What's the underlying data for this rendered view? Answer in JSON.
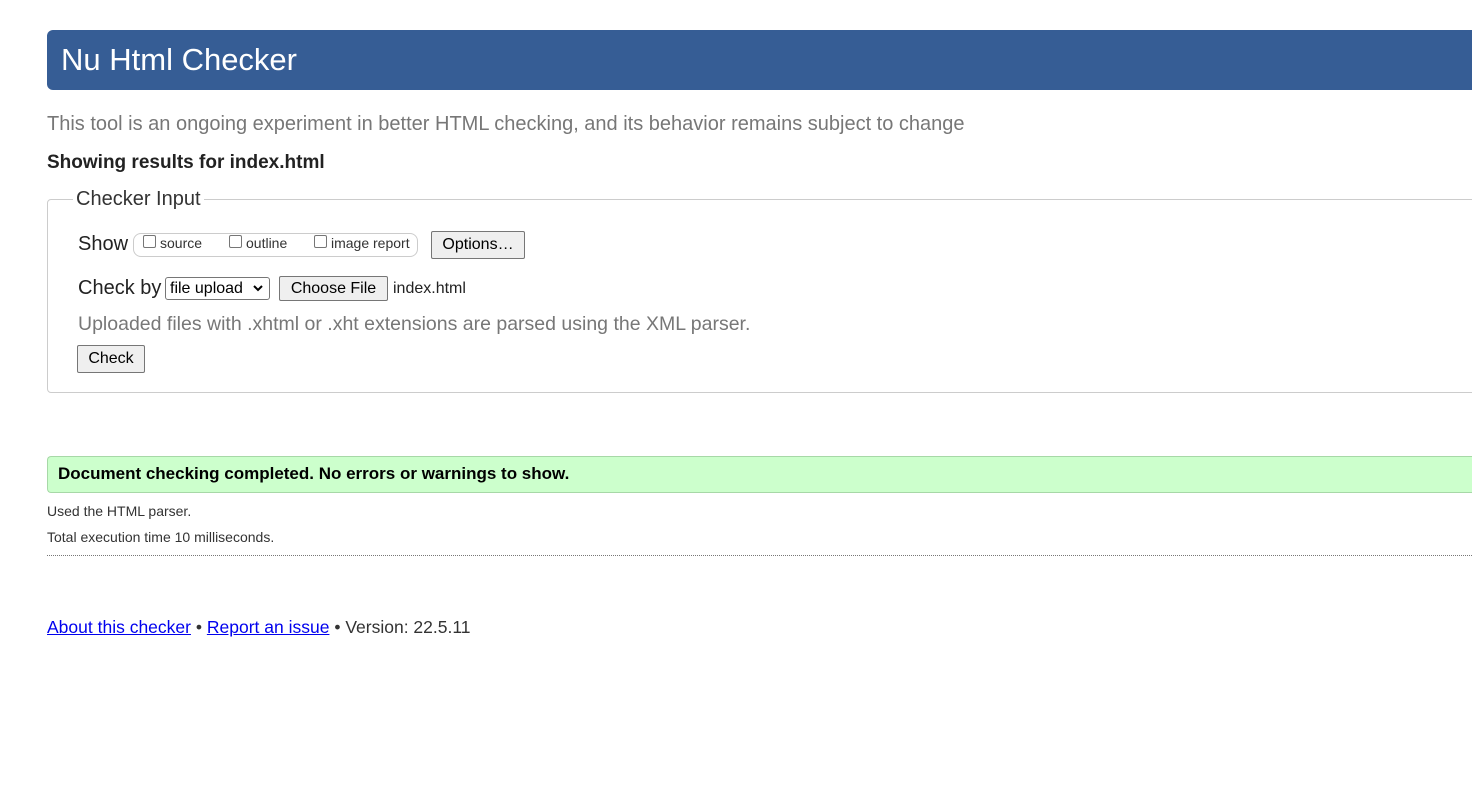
{
  "header": {
    "title": "Nu Html Checker"
  },
  "subtitle": "This tool is an ongoing experiment in better HTML checking, and its behavior remains subject to change",
  "results_for": "Showing results for index.html",
  "checker_input": {
    "legend": "Checker Input",
    "show_label": "Show",
    "show_options": [
      {
        "label": "source",
        "checked": false
      },
      {
        "label": "outline",
        "checked": false
      },
      {
        "label": "image report",
        "checked": false
      }
    ],
    "options_button": "Options…",
    "check_by_label": "Check by",
    "check_by_selected": "file upload",
    "choose_file_button": "Choose File",
    "file_name": "index.html",
    "hint": "Uploaded files with .xhtml or .xht extensions are parsed using the XML parser.",
    "check_button": "Check"
  },
  "result": {
    "success_message": "Document checking completed. No errors or warnings to show.",
    "parser_note": "Used the HTML parser.",
    "execution_time": "Total execution time 10 milliseconds."
  },
  "footer": {
    "about_link": "About this checker",
    "separator": "•",
    "report_link": "Report an issue",
    "version": "Version: 22.5.11"
  },
  "colors": {
    "header_bg": "#365d95",
    "success_bg": "#ccffcc",
    "link": "#0000ee"
  }
}
